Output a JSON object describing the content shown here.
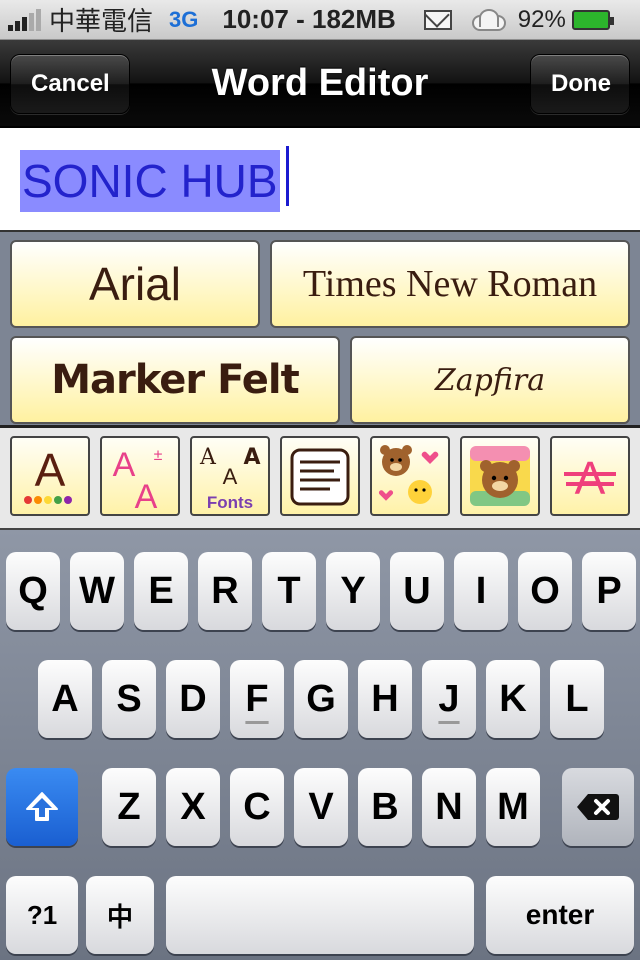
{
  "status": {
    "carrier": "中華電信",
    "network": "3G",
    "time_info": "10:07 - 182MB",
    "battery": "92%"
  },
  "nav": {
    "title": "Word Editor",
    "cancel": "Cancel",
    "done": "Done"
  },
  "editor": {
    "text": "SONIC HUB"
  },
  "fonts": {
    "arial": "Arial",
    "times": "Times New Roman",
    "marker": "Marker Felt",
    "zapfino": "Zapfira"
  },
  "tools": [
    {
      "name": "text-color-icon"
    },
    {
      "name": "text-size-icon"
    },
    {
      "name": "fonts-icon",
      "label": "Fonts"
    },
    {
      "name": "text-align-icon"
    },
    {
      "name": "stickers-icon"
    },
    {
      "name": "bear-background-icon"
    },
    {
      "name": "text-effect-icon"
    }
  ],
  "keyboard": {
    "row1": [
      "Q",
      "W",
      "E",
      "R",
      "T",
      "Y",
      "U",
      "I",
      "O",
      "P"
    ],
    "row2": [
      "A",
      "S",
      "D",
      "F",
      "G",
      "H",
      "J",
      "K",
      "L"
    ],
    "row3": [
      "Z",
      "X",
      "C",
      "V",
      "B",
      "N",
      "M"
    ],
    "numbers": "?1",
    "lang": "中",
    "enter": "enter"
  },
  "colors": {
    "selection": "#8a8bff",
    "selected_text": "#2323cc",
    "shift_active": "#1a5fd1",
    "font_button_bg": "#fff5b8"
  }
}
